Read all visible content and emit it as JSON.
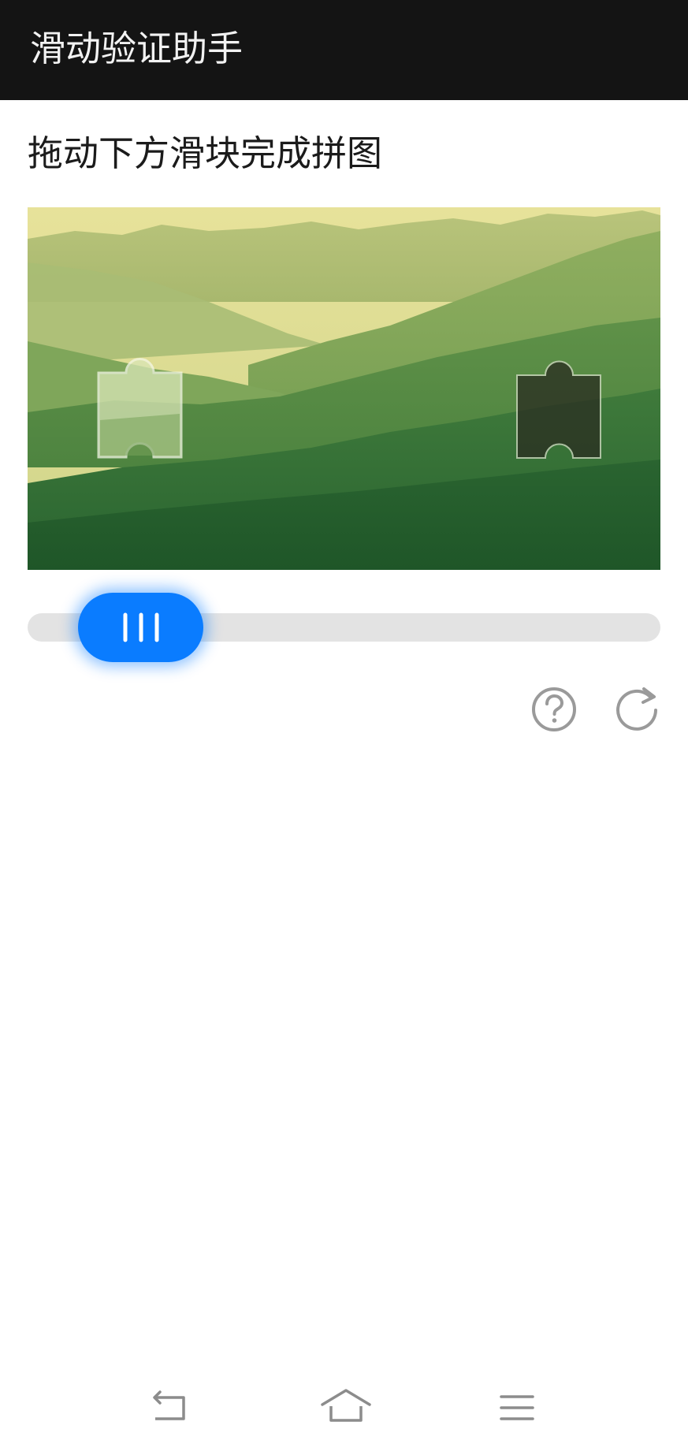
{
  "app_bar": {
    "title": "滑动验证助手"
  },
  "captcha": {
    "instruction": "拖动下方滑块完成拼图",
    "slider": {
      "progress": 0.09
    }
  },
  "icons": {
    "help": "help-circle-icon",
    "refresh": "refresh-icon",
    "grip": "grip-lines-icon",
    "nav_back": "back-icon",
    "nav_home": "home-icon",
    "nav_menu": "menu-icon"
  },
  "colors": {
    "app_bar_bg": "#141414",
    "accent": "#0a7cff",
    "track": "#e3e3e3",
    "icon_gray": "#9a9a9a"
  }
}
